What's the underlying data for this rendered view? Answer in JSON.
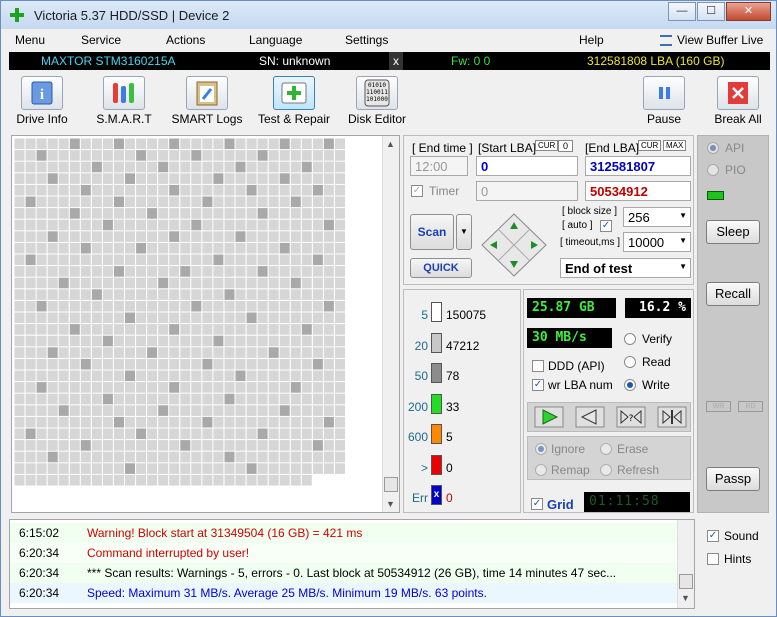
{
  "window": {
    "title": "Victoria 5.37 HDD/SSD | Device 2",
    "min_label": "—",
    "max_label": "☐",
    "close_label": "✕"
  },
  "menu": {
    "items": [
      "Menu",
      "Service",
      "Actions",
      "Language",
      "Settings",
      "Help"
    ],
    "view_buffer": "View Buffer Live"
  },
  "info": {
    "model": "MAXTOR STM3160215A",
    "sn": "SN: unknown",
    "x": "x",
    "fw": "Fw: 0 0",
    "lba": "312581808 LBA (160 GB)"
  },
  "toolbar": {
    "drive_info": "Drive Info",
    "smart": "S.M.A.R.T",
    "smart_logs": "SMART Logs",
    "test_repair": "Test & Repair",
    "disk_editor": "Disk Editor",
    "pause": "Pause",
    "break_all": "Break All",
    "disk_editor_icon_text": "01010\n110011\n101000\n00101"
  },
  "test": {
    "end_time_label": "[ End time ]",
    "start_lba_label": "[Start LBA]",
    "cur_label": "CUR",
    "zero_label": "0",
    "end_lba_label": "[End LBA]",
    "max_label": "MAX",
    "time_value": "12:00",
    "start_lba": "0",
    "end_lba": "312581807",
    "timer_label": "Timer",
    "timer_value": "0",
    "current_lba": "50534912",
    "block_size_label": "[ block size ]",
    "auto_label": "[ auto ]",
    "block_size": "256",
    "timeout_label": "[ timeout,ms ]",
    "timeout": "10000",
    "scan_label": "Scan",
    "quick_label": "QUICK",
    "end_mode": "End of test"
  },
  "stats": {
    "rows": [
      {
        "ms": "5",
        "count": "150075",
        "color": "#ffffff"
      },
      {
        "ms": "20",
        "count": "47212",
        "color": "#c8c8c8"
      },
      {
        "ms": "50",
        "count": "78",
        "color": "#8c8c8c"
      },
      {
        "ms": "200",
        "count": "33",
        "color": "#22dd22"
      },
      {
        "ms": "600",
        "count": "5",
        "color": "#ff8800"
      },
      {
        "ms": ">",
        "count": "0",
        "color": "#ee0000"
      },
      {
        "ms": "Err",
        "count": "0",
        "color": "#0000cc"
      }
    ]
  },
  "status": {
    "gb": "25.87 GB",
    "percent": "16.2",
    "percent_sign": "%",
    "speed": "30 MB/s",
    "ddd_label": "DDD (API)",
    "wr_lba_label": "wr LBA num",
    "verify": "Verify",
    "read": "Read",
    "write": "Write",
    "ignore": "Ignore",
    "erase": "Erase",
    "remap": "Remap",
    "refresh": "Refresh",
    "grid_label": "Grid",
    "timer": "01:11:58",
    "err_box": "x"
  },
  "side": {
    "api": "API",
    "pio": "PIO",
    "sleep": "Sleep",
    "recall": "Recall",
    "wr": "WR",
    "rd": "RD",
    "passp": "Passp"
  },
  "log": [
    {
      "time": "6:15:02",
      "msg": "Warning! Block start at 31349504 (16 GB)  = 421 ms",
      "color": "#d40000"
    },
    {
      "time": "6:20:34",
      "msg": "Command interrupted by user!",
      "color": "#d40000"
    },
    {
      "time": "6:20:34",
      "msg": "*** Scan results: Warnings - 5, errors - 0. Last block at 50534912 (26 GB), time 14 minutes 47 sec...",
      "color": "#000000"
    },
    {
      "time": "6:20:34",
      "msg": "Speed: Maximum 31 MB/s. Average 25 MB/s. Minimum 19 MB/s. 63 points.",
      "color": "#0000e0"
    }
  ],
  "options": {
    "sound": "Sound",
    "hints": "Hints"
  }
}
